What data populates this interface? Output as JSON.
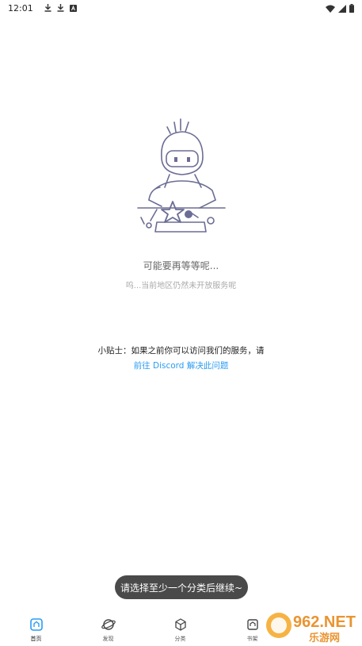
{
  "status_bar": {
    "time": "12:01",
    "left_icons": [
      "download-icon",
      "download-icon",
      "a-icon"
    ],
    "right_icons": [
      "wifi-icon",
      "signal-icon",
      "battery-icon"
    ]
  },
  "empty_state": {
    "title": "可能要再等等呢...",
    "subtitle": "呜...当前地区仍然未开放服务呢"
  },
  "tip": {
    "text": "小贴士：如果之前你可以访问我们的服务，请",
    "link": "前往 Discord 解决此问题"
  },
  "toast": {
    "message": "请选择至少一个分类后继续~"
  },
  "bottom_nav": {
    "items": [
      {
        "label": "首页",
        "icon": "home-icon",
        "active": true
      },
      {
        "label": "发现",
        "icon": "planet-icon",
        "active": false
      },
      {
        "label": "分类",
        "icon": "cube-icon",
        "active": false
      },
      {
        "label": "书架",
        "icon": "bookshelf-icon",
        "active": false
      }
    ]
  },
  "watermark": {
    "brand": "962.NET",
    "subtitle": "乐游网"
  },
  "colors": {
    "accent": "#2a9df4",
    "nav_active": "#2a9df4",
    "toast_bg": "#4a4a4a",
    "illustration": "#6b6d94"
  }
}
